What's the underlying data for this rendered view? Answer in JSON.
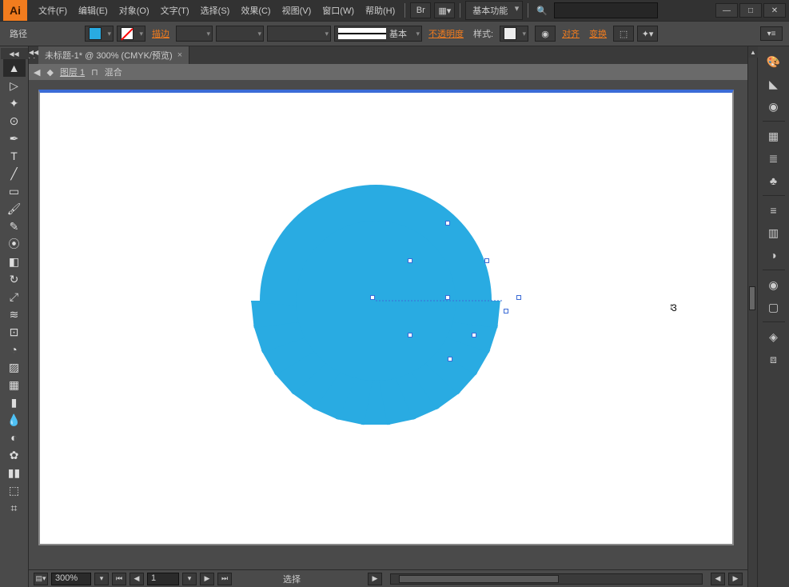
{
  "app": {
    "logo": "Ai"
  },
  "menu": {
    "file": "文件(F)",
    "edit": "编辑(E)",
    "object": "对象(O)",
    "type": "文字(T)",
    "select": "选择(S)",
    "effect": "效果(C)",
    "view": "视图(V)",
    "window": "窗口(W)",
    "help": "帮助(H)"
  },
  "titlebar": {
    "bridge": "Br",
    "workspace": "基本功能"
  },
  "win": {
    "min": "—",
    "max": "□",
    "close": "✕"
  },
  "control": {
    "selection_label": "路径",
    "stroke": "描边",
    "stroke_style": "基本",
    "opacity": "不透明度",
    "style": "样式:",
    "align": "对齐",
    "transform": "变换",
    "fill_color": "#29abe2",
    "no_stroke": true
  },
  "doc": {
    "tab": "未标题-1* @ 300% (CMYK/预览)",
    "tab_close": "×"
  },
  "layer": {
    "name": "图层 1",
    "blend": "混合"
  },
  "status": {
    "zoom": "300%",
    "page": "1",
    "mode": "选择"
  },
  "canvas": {
    "shape_color": "#29abe2",
    "cursor_text": "3"
  },
  "icons": {
    "back": "◀",
    "layers": "◆"
  }
}
